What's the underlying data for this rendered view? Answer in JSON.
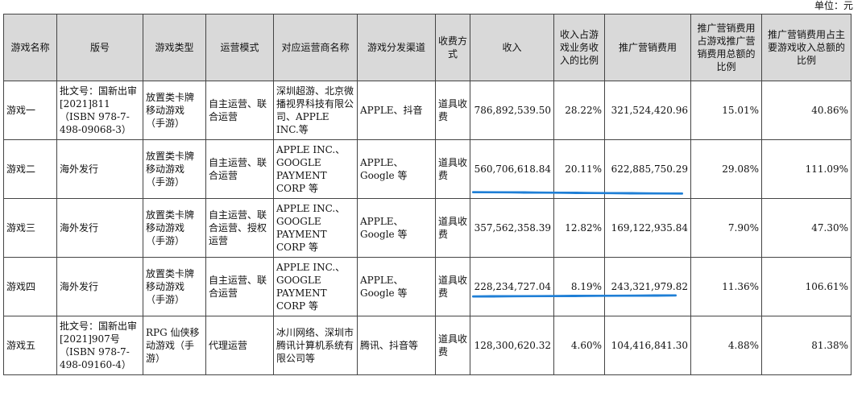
{
  "unit_label": "单位：元",
  "headers": [
    "游戏名称",
    "版号",
    "游戏类型",
    "运营模式",
    "对应运营商名称",
    "游戏分发渠道",
    "收费方式",
    "收入",
    "收入占游戏业务收入的比例",
    "推广营销费用",
    "推广营销费用占游戏推广营销费用总额的比例",
    "推广营销费用占主要游戏收入总额的比例"
  ],
  "rows": [
    {
      "name": "游戏一",
      "license": "批文号：国新出审[2021]811（ISBN 978-7-498-09068-3）",
      "type": "放置类卡牌移动游戏（手游）",
      "mode": "自主运营、联合运营",
      "operator": "深圳超游、北京微播视界科技有限公司、APPLE INC.等",
      "channel": "APPLE、抖音",
      "fee": "道具收费",
      "revenue": "786,892,539.50",
      "revenue_pct": "28.22%",
      "marketing": "321,524,420.96",
      "marketing_pct": "15.01%",
      "marketing_rev_pct": "40.86%"
    },
    {
      "name": "游戏二",
      "license": "海外发行",
      "type": "放置类卡牌移动游戏（手游）",
      "mode": "自主运营、联合运营",
      "operator": "APPLE INC.、GOOGLE PAYMENT CORP 等",
      "channel": "APPLE、Google 等",
      "fee": "道具收费",
      "revenue": "560,706,618.84",
      "revenue_pct": "20.11%",
      "marketing": "622,885,750.29",
      "marketing_pct": "29.08%",
      "marketing_rev_pct": "111.09%"
    },
    {
      "name": "游戏三",
      "license": "海外发行",
      "type": "放置类卡牌移动游戏（手游）",
      "mode": "自主运营、联合运营、授权运营",
      "operator": "APPLE INC.、GOOGLE PAYMENT CORP 等",
      "channel": "APPLE、Google 等",
      "fee": "道具收费",
      "revenue": "357,562,358.39",
      "revenue_pct": "12.82%",
      "marketing": "169,122,935.84",
      "marketing_pct": "7.90%",
      "marketing_rev_pct": "47.30%"
    },
    {
      "name": "游戏四",
      "license": "海外发行",
      "type": "放置类卡牌移动游戏（手游）",
      "mode": "自主运营、联合运营",
      "operator": "APPLE INC.、GOOGLE PAYMENT CORP 等",
      "channel": "APPLE、Google 等",
      "fee": "道具收费",
      "revenue": "228,234,727.04",
      "revenue_pct": "8.19%",
      "marketing": "243,321,979.82",
      "marketing_pct": "11.36%",
      "marketing_rev_pct": "106.61%"
    },
    {
      "name": "游戏五",
      "license": "批文号：国新出审[2021]907号（ISBN 978-7-498-09160-4）",
      "type": "RPG 仙侠移动游戏（手游）",
      "mode": "代理运营",
      "operator": "冰川网络、深圳市腾讯计算机系统有限公司等",
      "channel": "腾讯、抖音等",
      "fee": "道具收费",
      "revenue": "128,300,620.32",
      "revenue_pct": "4.60%",
      "marketing": "104,416,841.30",
      "marketing_pct": "4.88%",
      "marketing_rev_pct": "81.38%"
    }
  ],
  "annotation_color": "#1f7fd6"
}
